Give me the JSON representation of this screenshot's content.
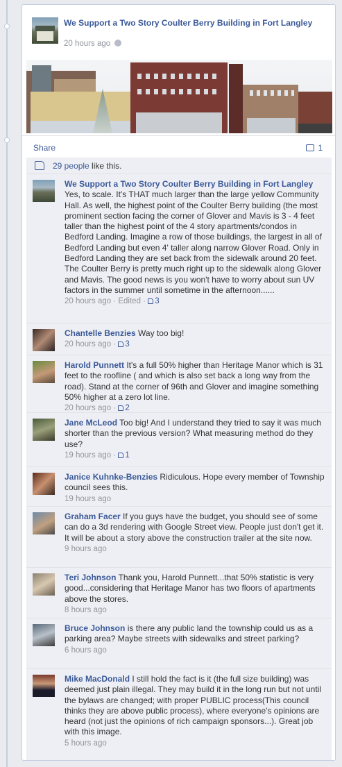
{
  "post": {
    "page_name": "We Support a Two Story Coulter Berry Building in Fort Langley",
    "time": "20 hours ago",
    "share_label": "Share",
    "comment_count": "1",
    "likes_count": "29 people",
    "likes_suffix": " like this."
  },
  "comments": [
    {
      "author": "We Support a Two Story Coulter Berry Building in Fort Langley",
      "text": " Yes, to scale. It's THAT much larger than the large yellow Community Hall. As well, the highest point of the Coulter Berry building (the most prominent section facing the corner of Glover and Mavis is 3 - 4 feet taller than the highest point of the 4 story apartments/condos in Bedford Landing. Imagine a row of those buildings, the largest in all of Bedford Landing but even 4' taller along narrow Glover Road. Only in Bedford Landing they are set back from the sidewalk around 20 feet. The Coulter Berry is pretty much right up to the sidewalk along Glover and Mavis. The good news is you won't have to worry about sun UV factors in the summer until sometime in the afternoon......",
      "time": "20 hours ago",
      "edited": " · Edited · ",
      "likes": "3"
    },
    {
      "author": "Chantelle Benzies",
      "text": " Way too big!",
      "time": "20 hours ago",
      "likes": "3"
    },
    {
      "author": "Harold Punnett",
      "text": " It's a full 50% higher than Heritage Manor which is 31 feet to the roofline ( and which is also set back a long way from the road). Stand at the corner of 96th and Glover and imagine something 50% higher at a zero lot line.",
      "time": "20 hours ago",
      "likes": "2"
    },
    {
      "author": "Jane McLeod",
      "text": " Too big! And I understand they tried to say it was much shorter than the previous version? What measuring method do they use?",
      "time": "19 hours ago",
      "likes": "1"
    },
    {
      "author": "Janice Kuhnke-Benzies",
      "text": " Ridiculous. Hope every member of Township council sees this.",
      "time": "19 hours ago"
    },
    {
      "author": "Graham Facer",
      "text": " If you guys have the budget, you should see of some can do a 3d rendering with Google Street view. People just don't get it. It will be about a story above the construction trailer at the site now.",
      "time": "9 hours ago"
    },
    {
      "author": "Teri Johnson",
      "text": " Thank you, Harold Punnett...that 50% statistic is very good...considering that Heritage Manor has two floors of apartments above the stores.",
      "time": "8 hours ago"
    },
    {
      "author": "Bruce Johnson",
      "text": " is there any public land the township could us as a parking area? Maybe streets with sidewalks and street parking?",
      "time": "6 hours ago"
    },
    {
      "author": "Mike MacDonald",
      "text": " I still hold the fact is it (the full size building) was deemed just plain illegal. They may build it in the long run but not until the bylaws are changed; with proper PUBLIC process(This council thinks they are above public process), where everyone's opinions are heard (not just the opinions of rich campaign sponsors...). Great job with this image.",
      "time": "5 hours ago"
    }
  ],
  "colors": {
    "link": "#3b5998",
    "comment_bg": "#edeff4",
    "meta": "#90949c"
  }
}
